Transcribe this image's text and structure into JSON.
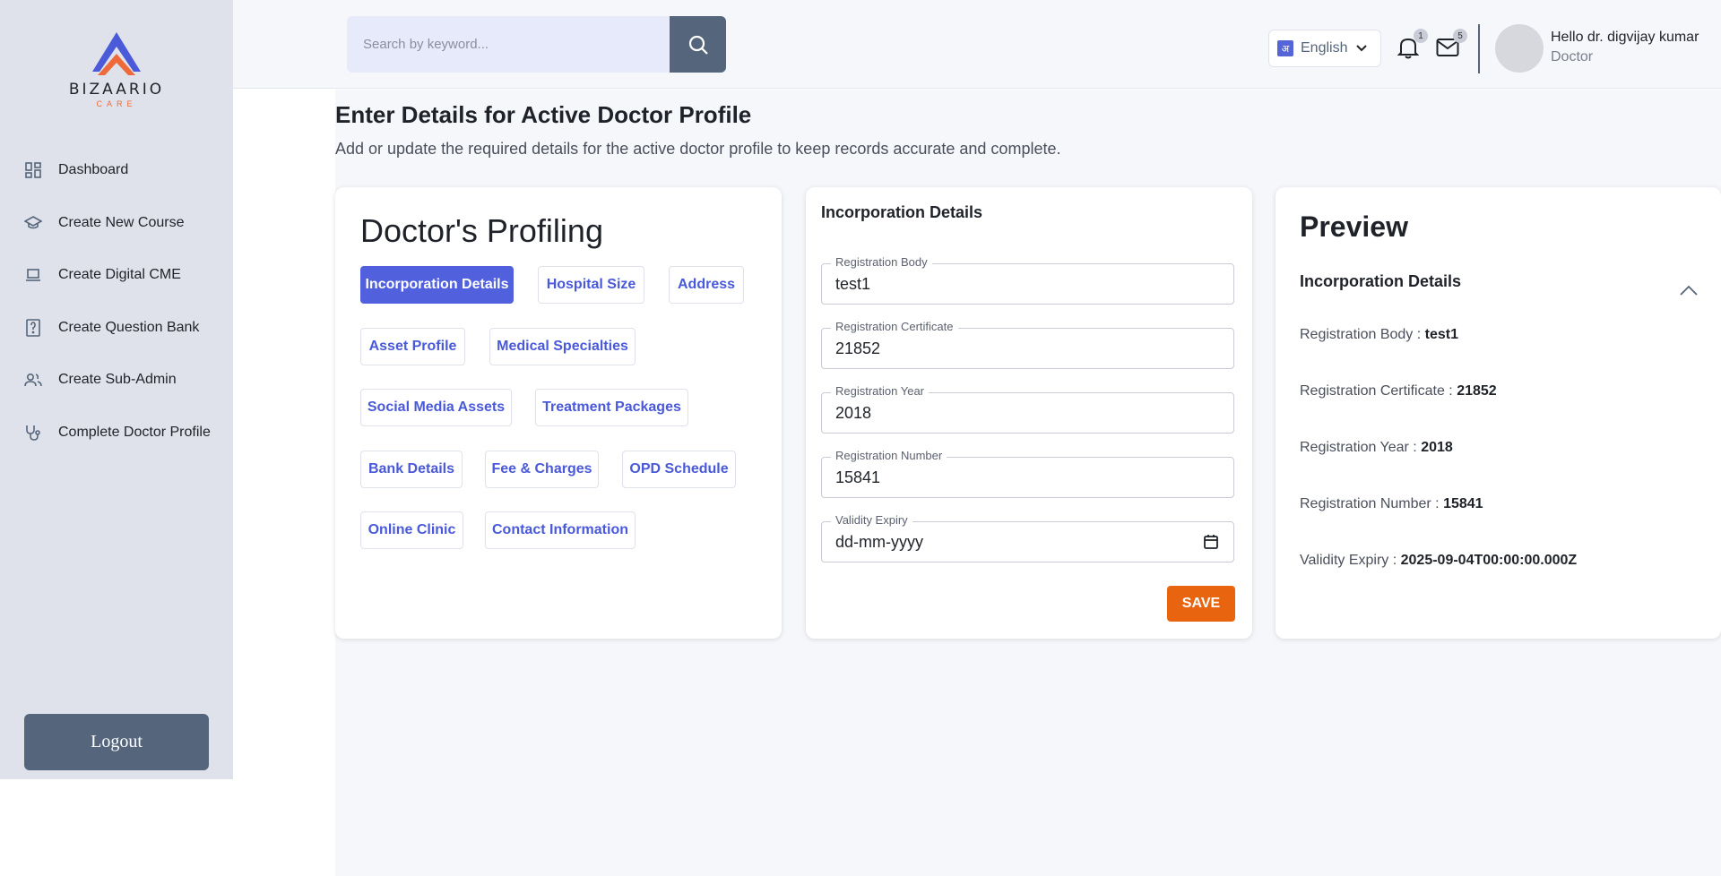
{
  "brand": {
    "name": "BIZAARIO",
    "tagline": "CARE"
  },
  "sidebar": {
    "items": [
      {
        "label": "Dashboard",
        "icon": "dashboard-icon"
      },
      {
        "label": "Create New Course",
        "icon": "graduation-cap-icon"
      },
      {
        "label": "Create Digital CME",
        "icon": "laptop-icon"
      },
      {
        "label": "Create Question Bank",
        "icon": "question-file-icon"
      },
      {
        "label": "Create Sub-Admin",
        "icon": "users-icon"
      },
      {
        "label": "Complete Doctor Profile",
        "icon": "stethoscope-icon"
      }
    ],
    "logout": "Logout"
  },
  "topbar": {
    "search_placeholder": "Search by keyword...",
    "language": "English",
    "language_glyph": "अ",
    "notifications_count": "1",
    "messages_count": "5",
    "user_greeting": "Hello dr. digvijay kumar",
    "user_role": "Doctor"
  },
  "page": {
    "title": "Enter Details for Active Doctor Profile",
    "subtitle": "Add or update the required details for the active doctor profile to keep records accurate and complete."
  },
  "profiling": {
    "title": "Doctor's Profiling",
    "sections": [
      "Incorporation Details",
      "Hospital Size",
      "Address",
      "Asset Profile",
      "Medical Specialties",
      "Social Media Assets",
      "Treatment Packages",
      "Bank Details",
      "Fee & Charges",
      "OPD Schedule",
      "Online Clinic",
      "Contact Information"
    ],
    "active": "Incorporation Details"
  },
  "form": {
    "title": "Incorporation Details",
    "fields": [
      {
        "label": "Registration Body",
        "value": "test1"
      },
      {
        "label": "Registration Certificate",
        "value": "21852"
      },
      {
        "label": "Registration Year",
        "value": "2018"
      },
      {
        "label": "Registration Number",
        "value": "15841"
      },
      {
        "label": "Validity Expiry",
        "value": "dd-mm-yyyy"
      }
    ],
    "save": "SAVE"
  },
  "preview": {
    "title": "Preview",
    "section": "Incorporation Details",
    "rows": [
      {
        "label": "Registration Body : ",
        "value": "test1"
      },
      {
        "label": "Registration Certificate : ",
        "value": "21852"
      },
      {
        "label": "Registration Year : ",
        "value": "2018"
      },
      {
        "label": "Registration Number : ",
        "value": "15841"
      },
      {
        "label": "Validity Expiry : ",
        "value": "2025-09-04T00:00:00.000Z"
      }
    ]
  },
  "colors": {
    "primary": "#5160dc",
    "sidebar": "#dfe2ea",
    "slate": "#55657b",
    "save": "#e8640f",
    "brand_accent": "#ef6a3a"
  }
}
